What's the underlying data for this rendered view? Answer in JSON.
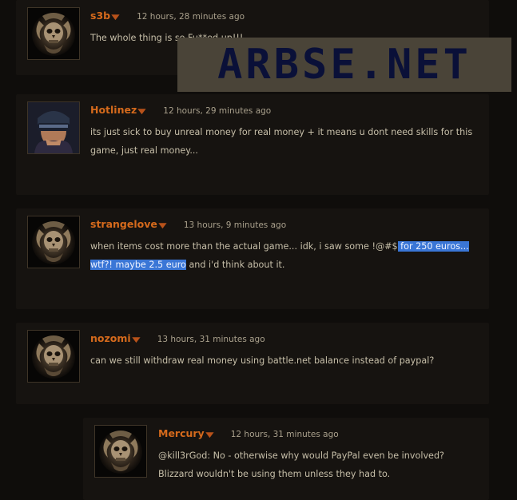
{
  "watermark": "ARBSE.NET",
  "posts": [
    {
      "author": "s3b",
      "time": "12 hours, 28 minutes ago",
      "body": "The whole thing is so Fu**ed up!!!",
      "avatar": "diablo-skull-avatar"
    },
    {
      "author": "Hotlinez",
      "time": "12 hours, 29 minutes ago",
      "body": "its just sick to buy unreal money for real money + it means u dont need skills for this game, just real money...",
      "avatar": "visor-soldier-avatar"
    },
    {
      "author": "strangelove",
      "time": "13 hours, 9 minutes ago",
      "body_before": "when items cost more than the actual game... idk, i saw some !@#$",
      "body_highlight": " for 250 euros... wtf?! maybe 2.5 euro",
      "body_after": " and i'd think about it.",
      "avatar": "diablo-skull-avatar"
    },
    {
      "author": "nozomi",
      "time": "13 hours, 31 minutes ago",
      "body": "can we still withdraw real money using battle.net balance instead of paypal?",
      "avatar": "diablo-skull-avatar"
    },
    {
      "author": "Mercury",
      "time": "12 hours, 31 minutes ago",
      "body": "@kill3rGod: No - otherwise why would PayPal even be involved? Blizzard wouldn't be using them unless they had to.",
      "avatar": "diablo-skull-avatar"
    }
  ],
  "icons": {
    "dropdown": "chevron-down-icon"
  },
  "colors": {
    "author": "#d56a1c",
    "highlight": "#3a76d6",
    "background": "#0f0d0b"
  }
}
